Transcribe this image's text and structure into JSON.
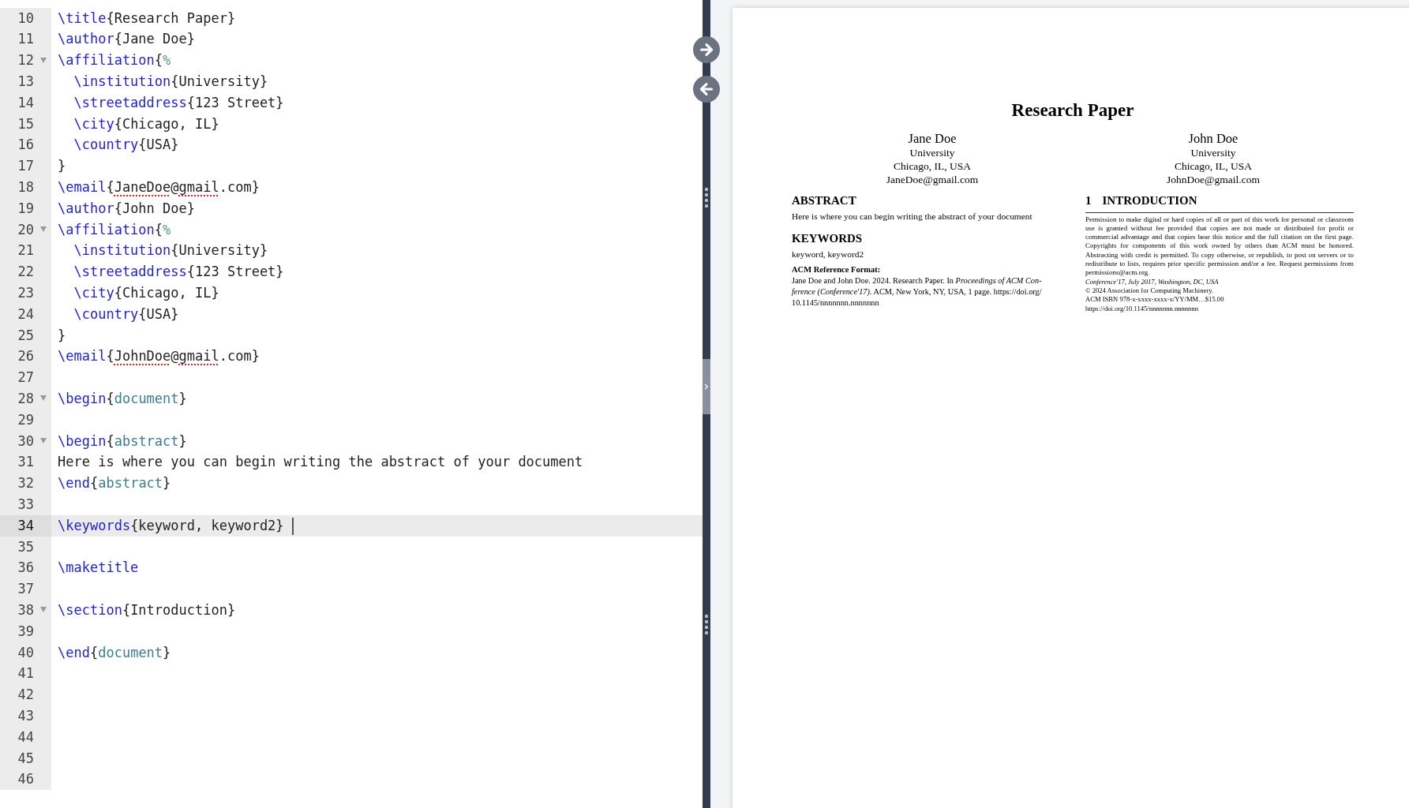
{
  "editor": {
    "lines": [
      {
        "number": "10",
        "foldable": false,
        "active": false,
        "tokens": [
          {
            "kind": "command",
            "text": "\\title"
          },
          {
            "kind": "text",
            "text": "{Research Paper}"
          }
        ]
      },
      {
        "number": "11",
        "foldable": false,
        "active": false,
        "tokens": [
          {
            "kind": "command",
            "text": "\\author"
          },
          {
            "kind": "text",
            "text": "{Jane Doe}"
          }
        ]
      },
      {
        "number": "12",
        "foldable": true,
        "active": false,
        "tokens": [
          {
            "kind": "command",
            "text": "\\affiliation"
          },
          {
            "kind": "text",
            "text": "{"
          },
          {
            "kind": "comment",
            "text": "%"
          }
        ]
      },
      {
        "number": "13",
        "foldable": false,
        "active": false,
        "tokens": [
          {
            "kind": "command",
            "text": "  \\institution"
          },
          {
            "kind": "text",
            "text": "{University}"
          }
        ]
      },
      {
        "number": "14",
        "foldable": false,
        "active": false,
        "tokens": [
          {
            "kind": "command",
            "text": "  \\streetaddress"
          },
          {
            "kind": "text",
            "text": "{123 Street}"
          }
        ]
      },
      {
        "number": "15",
        "foldable": false,
        "active": false,
        "tokens": [
          {
            "kind": "command",
            "text": "  \\city"
          },
          {
            "kind": "text",
            "text": "{Chicago, IL}"
          }
        ]
      },
      {
        "number": "16",
        "foldable": false,
        "active": false,
        "tokens": [
          {
            "kind": "command",
            "text": "  \\country"
          },
          {
            "kind": "text",
            "text": "{USA}"
          }
        ]
      },
      {
        "number": "17",
        "foldable": false,
        "active": false,
        "tokens": [
          {
            "kind": "text",
            "text": "}"
          }
        ]
      },
      {
        "number": "18",
        "foldable": false,
        "active": false,
        "tokens": [
          {
            "kind": "command",
            "text": "\\email"
          },
          {
            "kind": "text",
            "text": "{"
          },
          {
            "kind": "text",
            "text": "JaneDoe",
            "misspelled": true
          },
          {
            "kind": "text",
            "text": "@"
          },
          {
            "kind": "text",
            "text": "gmail",
            "misspelled": true
          },
          {
            "kind": "text",
            "text": ".com}"
          }
        ]
      },
      {
        "number": "19",
        "foldable": false,
        "active": false,
        "tokens": [
          {
            "kind": "command",
            "text": "\\author"
          },
          {
            "kind": "text",
            "text": "{John Doe}"
          }
        ]
      },
      {
        "number": "20",
        "foldable": true,
        "active": false,
        "tokens": [
          {
            "kind": "command",
            "text": "\\affiliation"
          },
          {
            "kind": "text",
            "text": "{"
          },
          {
            "kind": "comment",
            "text": "%"
          }
        ]
      },
      {
        "number": "21",
        "foldable": false,
        "active": false,
        "tokens": [
          {
            "kind": "command",
            "text": "  \\institution"
          },
          {
            "kind": "text",
            "text": "{University}"
          }
        ]
      },
      {
        "number": "22",
        "foldable": false,
        "active": false,
        "tokens": [
          {
            "kind": "command",
            "text": "  \\streetaddress"
          },
          {
            "kind": "text",
            "text": "{123 Street}"
          }
        ]
      },
      {
        "number": "23",
        "foldable": false,
        "active": false,
        "tokens": [
          {
            "kind": "command",
            "text": "  \\city"
          },
          {
            "kind": "text",
            "text": "{Chicago, IL}"
          }
        ]
      },
      {
        "number": "24",
        "foldable": false,
        "active": false,
        "tokens": [
          {
            "kind": "command",
            "text": "  \\country"
          },
          {
            "kind": "text",
            "text": "{USA}"
          }
        ]
      },
      {
        "number": "25",
        "foldable": false,
        "active": false,
        "tokens": [
          {
            "kind": "text",
            "text": "}"
          }
        ]
      },
      {
        "number": "26",
        "foldable": false,
        "active": false,
        "tokens": [
          {
            "kind": "command",
            "text": "\\email"
          },
          {
            "kind": "text",
            "text": "{"
          },
          {
            "kind": "text",
            "text": "JohnDoe",
            "misspelled": true
          },
          {
            "kind": "text",
            "text": "@"
          },
          {
            "kind": "text",
            "text": "gmail",
            "misspelled": true
          },
          {
            "kind": "text",
            "text": ".com}"
          }
        ]
      },
      {
        "number": "27",
        "foldable": false,
        "active": false
      },
      {
        "number": "28",
        "foldable": true,
        "active": false,
        "tokens": [
          {
            "kind": "command",
            "text": "\\begin"
          },
          {
            "kind": "text",
            "text": "{"
          },
          {
            "kind": "env",
            "text": "document"
          },
          {
            "kind": "text",
            "text": "}"
          }
        ]
      },
      {
        "number": "29",
        "foldable": false,
        "active": false
      },
      {
        "number": "30",
        "foldable": true,
        "active": false,
        "tokens": [
          {
            "kind": "command",
            "text": "\\begin"
          },
          {
            "kind": "text",
            "text": "{"
          },
          {
            "kind": "env",
            "text": "abstract"
          },
          {
            "kind": "text",
            "text": "}"
          }
        ]
      },
      {
        "number": "31",
        "foldable": false,
        "active": false,
        "tokens": [
          {
            "kind": "text",
            "text": "Here is where you can begin writing the abstract of your document"
          }
        ]
      },
      {
        "number": "32",
        "foldable": false,
        "active": false,
        "tokens": [
          {
            "kind": "command",
            "text": "\\end"
          },
          {
            "kind": "text",
            "text": "{"
          },
          {
            "kind": "env",
            "text": "abstract"
          },
          {
            "kind": "text",
            "text": "}"
          }
        ]
      },
      {
        "number": "33",
        "foldable": false,
        "active": false
      },
      {
        "number": "34",
        "foldable": false,
        "active": true,
        "tokens": [
          {
            "kind": "command",
            "text": "\\keywords"
          },
          {
            "kind": "text",
            "text": "{keyword, keyword2}"
          }
        ]
      },
      {
        "number": "35",
        "foldable": false,
        "active": false
      },
      {
        "number": "36",
        "foldable": false,
        "active": false,
        "tokens": [
          {
            "kind": "command",
            "text": "\\maketitle"
          }
        ]
      },
      {
        "number": "37",
        "foldable": false,
        "active": false
      },
      {
        "number": "38",
        "foldable": true,
        "active": false,
        "tokens": [
          {
            "kind": "command",
            "text": "\\section"
          },
          {
            "kind": "text",
            "text": "{Introduction}"
          }
        ]
      },
      {
        "number": "39",
        "foldable": false,
        "active": false
      },
      {
        "number": "40",
        "foldable": false,
        "active": false,
        "tokens": [
          {
            "kind": "command",
            "text": "\\end"
          },
          {
            "kind": "text",
            "text": "{"
          },
          {
            "kind": "env",
            "text": "document"
          },
          {
            "kind": "text",
            "text": "}"
          }
        ]
      },
      {
        "number": "41",
        "foldable": false,
        "active": false
      },
      {
        "number": "42",
        "foldable": false,
        "active": false
      },
      {
        "number": "43",
        "foldable": false,
        "active": false
      },
      {
        "number": "44",
        "foldable": false,
        "active": false
      },
      {
        "number": "45",
        "foldable": false,
        "active": false
      },
      {
        "number": "46",
        "foldable": false,
        "active": false
      }
    ]
  },
  "preview": {
    "title": "Research Paper",
    "authors": [
      {
        "name": "Jane Doe",
        "institution": "University",
        "location": "Chicago, IL, USA",
        "email": "JaneDoe@gmail.com"
      },
      {
        "name": "John Doe",
        "institution": "University",
        "location": "Chicago, IL, USA",
        "email": "JohnDoe@gmail.com"
      }
    ],
    "abstract": {
      "heading": "ABSTRACT",
      "text": "Here is where you can begin writing the abstract of your document"
    },
    "keywords": {
      "heading": "KEYWORDS",
      "text": "keyword, keyword2"
    },
    "reference_format": {
      "heading": "ACM Reference Format:",
      "lines": [
        "Jane Doe and John Doe. 2024. Research Paper. In *Proceedings of ACM Con-*",
        "*ference (Conference'17).* ACM, New York, NY, USA, 1 page. https://doi.org/",
        "10.1145/nnnnnnn.nnnnnnn"
      ]
    },
    "introduction": {
      "number": "1",
      "heading": "INTRODUCTION"
    },
    "permission": "Permission to make digital or hard copies of all or part of this work for personal or classroom use is granted without fee provided that copies are not made or distributed for profit or commercial advantage and that copies bear this notice and the full citation on the first page. Copyrights for components of this work owned by others than ACM must be honored. Abstracting with credit is permitted. To copy otherwise, or republish, to post on servers or to redistribute to lists, requires prior specific permission and/or a fee. Request permissions from permissions@acm.org.",
    "conference": "Conference'17, July 2017, Washington, DC, USA",
    "copyright_lines": [
      "© 2024 Association for Computing Machinery.",
      "ACM ISBN 978-x-xxxx-xxxx-x/YY/MM…$15.00",
      "https://doi.org/10.1145/nnnnnnn.nnnnnnn"
    ]
  }
}
